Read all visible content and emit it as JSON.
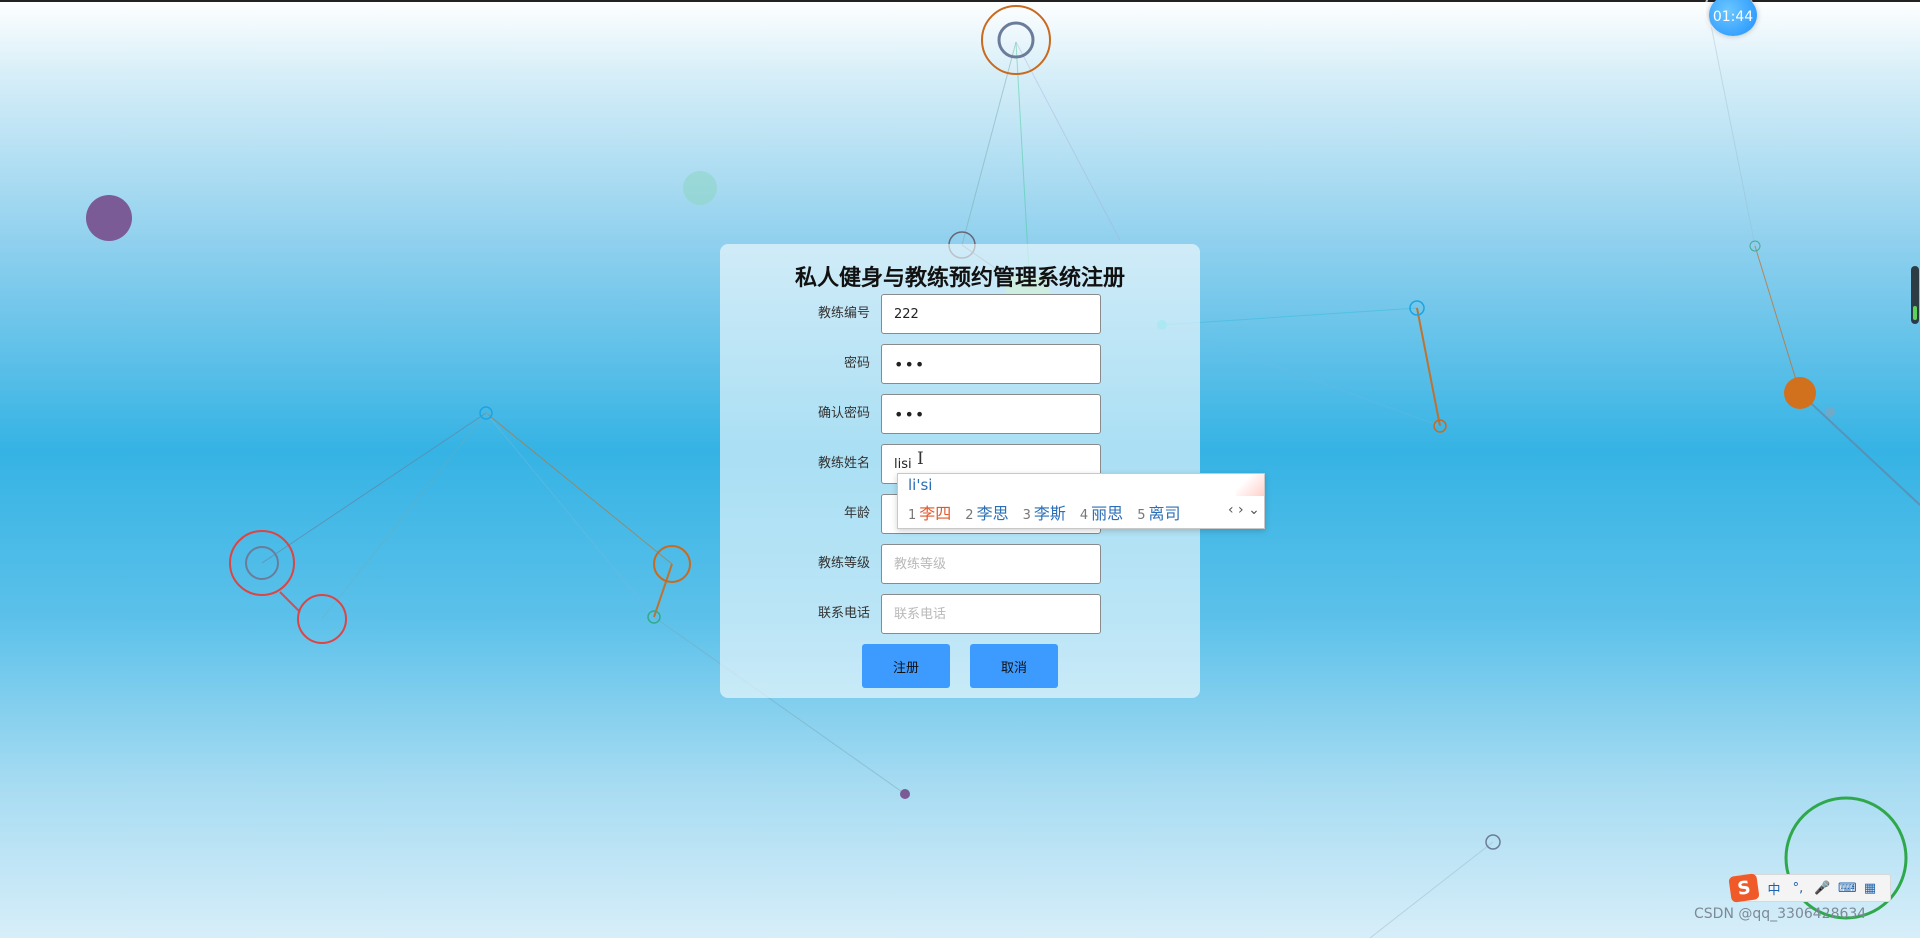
{
  "timer": {
    "text": "01:44"
  },
  "form": {
    "title": "私人健身与教练预约管理系统注册",
    "fields": [
      {
        "label": "教练编号",
        "value": "222",
        "placeholder": ""
      },
      {
        "label": "密码",
        "value": "•••",
        "placeholder": ""
      },
      {
        "label": "确认密码",
        "value": "•••",
        "placeholder": ""
      },
      {
        "label": "教练姓名",
        "value": "lisi",
        "placeholder": ""
      },
      {
        "label": "年龄",
        "value": "",
        "placeholder": ""
      },
      {
        "label": "教练等级",
        "value": "",
        "placeholder": "教练等级"
      },
      {
        "label": "联系电话",
        "value": "",
        "placeholder": "联系电话"
      }
    ],
    "buttons": {
      "register": "注册",
      "cancel": "取消"
    }
  },
  "ime": {
    "composition": "li'si",
    "candidates": [
      {
        "num": "1",
        "word": "李四"
      },
      {
        "num": "2",
        "word": "李思"
      },
      {
        "num": "3",
        "word": "李斯"
      },
      {
        "num": "4",
        "word": "丽思"
      },
      {
        "num": "5",
        "word": "离司"
      }
    ],
    "nav": "‹ › ⌄"
  },
  "ime_toolbar": {
    "logo": "S",
    "items": [
      "中",
      "°,",
      "🎤",
      "⌨",
      "▦"
    ]
  },
  "watermark": "CSDN @qq_3306428634",
  "colors": {
    "button": "#3d9bff",
    "active_candidate": "#e2572a",
    "candidate": "#2b6fb6"
  }
}
